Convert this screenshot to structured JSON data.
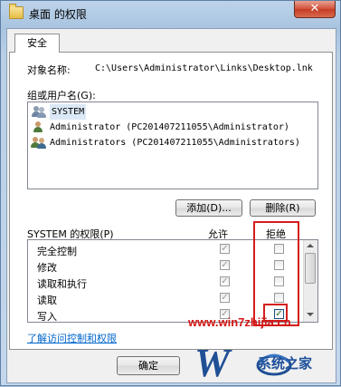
{
  "window": {
    "title": "桌面 的权限",
    "close_glyph": "✕"
  },
  "tab": {
    "label": "安全"
  },
  "object": {
    "label": "对象名称:",
    "value": "C:\\Users\\Administrator\\Links\\Desktop.lnk"
  },
  "groups": {
    "label": "组或用户名(G):",
    "items": [
      {
        "name": "SYSTEM",
        "icon": "system-users-icon"
      },
      {
        "name": "Administrator (PC201407211055\\Administrator)",
        "icon": "user-icon"
      },
      {
        "name": "Administrators (PC201407211055\\Administrators)",
        "icon": "group-users-icon"
      }
    ]
  },
  "buttons": {
    "add": "添加(D)...",
    "remove": "删除(R)",
    "ok": "确定"
  },
  "permissions": {
    "title": "SYSTEM 的权限(P)",
    "allow_header": "允许",
    "deny_header": "拒绝",
    "rows": [
      {
        "name": "完全控制",
        "allow": true,
        "deny": false
      },
      {
        "name": "修改",
        "allow": true,
        "deny": false
      },
      {
        "name": "读取和执行",
        "allow": true,
        "deny": false
      },
      {
        "name": "读取",
        "allow": true,
        "deny": false
      },
      {
        "name": "写入",
        "allow": true,
        "deny": true
      }
    ]
  },
  "link": {
    "text": "了解访问控制和权限"
  },
  "watermark": {
    "url": "www.win7zhijia.cn",
    "brand": "系统之家"
  },
  "colors": {
    "highlight_box": "#d41c1c",
    "link": "#0066cc",
    "title_bar": "#a9c4e0"
  }
}
